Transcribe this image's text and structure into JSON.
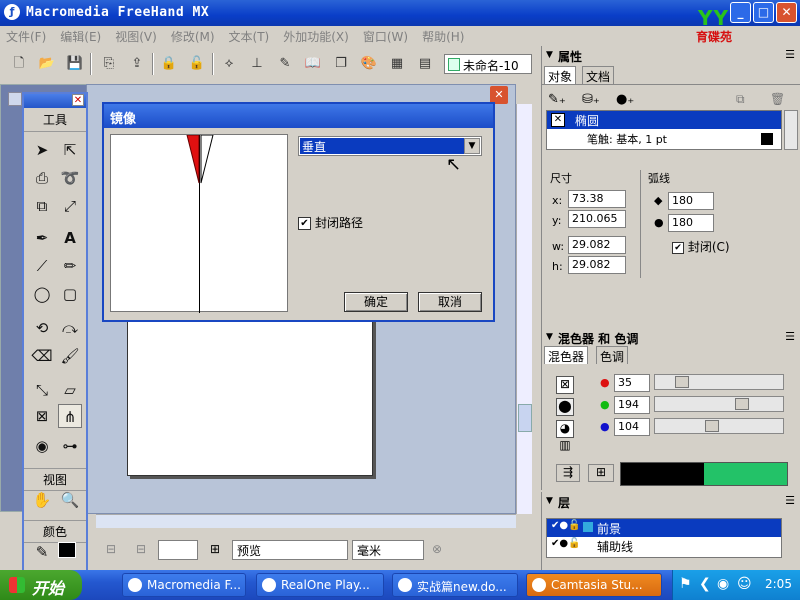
{
  "window": {
    "title": "Macromedia FreeHand MX",
    "min": "_",
    "max": "□",
    "close": "✕"
  },
  "logo": {
    "text": "育碟苑",
    "mark": "YY"
  },
  "menu": [
    "文件(F)",
    "编辑(E)",
    "视图(V)",
    "修改(M)",
    "文本(T)",
    "外加功能(X)",
    "窗口(W)",
    "帮助(H)"
  ],
  "toolbar": {
    "document_name": "未命名-10"
  },
  "tools": {
    "title": "工具",
    "view_title": "视图",
    "color_title": "颜色",
    "close": "✕"
  },
  "dialog": {
    "title": "镜像",
    "axis_option": "垂直",
    "close_path_label": "封闭路径",
    "close_path_checked": true,
    "ok": "确定",
    "cancel": "取消"
  },
  "properties": {
    "title": "属性",
    "tabs": [
      "对象",
      "文档"
    ],
    "object_name": "椭圆",
    "stroke": "笔触: 基本, 1 pt",
    "size_label": "尺寸",
    "arc_label": "弧线",
    "x_label": "x:",
    "x": "73.38",
    "y_label": "y:",
    "y": "210.065",
    "w_label": "w:",
    "w": "29.082",
    "h_label": "h:",
    "h": "29.082",
    "arc_start": "180",
    "arc_end": "180",
    "closed_label": "封闭(C)"
  },
  "mixer": {
    "title": "混色器 和 色调",
    "tabs": [
      "混色器",
      "色调"
    ],
    "r": "35",
    "g": "194",
    "b": "104",
    "swatch_color": "#23c268"
  },
  "layers": {
    "title": "层",
    "items": [
      "前景",
      "辅助线"
    ]
  },
  "statusbar": {
    "preview": "预览",
    "units": "毫米"
  },
  "taskbar": {
    "start": "开始",
    "tasks": [
      "Macromedia F...",
      "RealOne Play...",
      "实战篇new.do...",
      "Camtasia Stu..."
    ],
    "clock": "2:05"
  }
}
